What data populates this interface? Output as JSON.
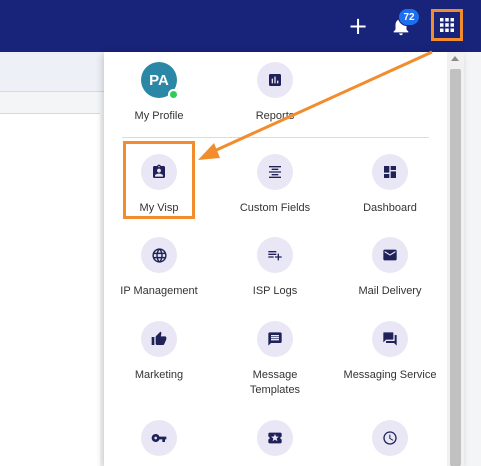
{
  "header": {
    "plus_label": "+",
    "notification_count": "72"
  },
  "apps_menu": {
    "profile": {
      "initials": "PA",
      "label": "My Profile"
    },
    "items": [
      {
        "label": "Reports",
        "icon": "bar-chart-icon"
      },
      {
        "label": "My Visp",
        "icon": "clipboard-account-icon"
      },
      {
        "label": "Custom Fields",
        "icon": "align-center-icon"
      },
      {
        "label": "Dashboard",
        "icon": "dashboard-icon"
      },
      {
        "label": "IP Management",
        "icon": "globe-icon"
      },
      {
        "label": "ISP Logs",
        "icon": "playlist-add-icon"
      },
      {
        "label": "Mail Delivery",
        "icon": "email-icon"
      },
      {
        "label": "Marketing",
        "icon": "thumbs-up-icon"
      },
      {
        "label": "Message Templates",
        "icon": "message-icon"
      },
      {
        "label": "Messaging Service",
        "icon": "forum-icon"
      },
      {
        "label": "",
        "icon": "key-icon"
      },
      {
        "label": "",
        "icon": "ticket-icon"
      },
      {
        "label": "",
        "icon": "clock-icon"
      }
    ]
  },
  "colors": {
    "header_bg": "#18237a",
    "accent_orange": "#f28c2c",
    "icon_circle": "#e9e7f5",
    "icon_color": "#1f2158",
    "badge_bg": "#1e6ff0",
    "avatar_bg": "#2b87a6",
    "online_dot": "#2ecc57"
  }
}
